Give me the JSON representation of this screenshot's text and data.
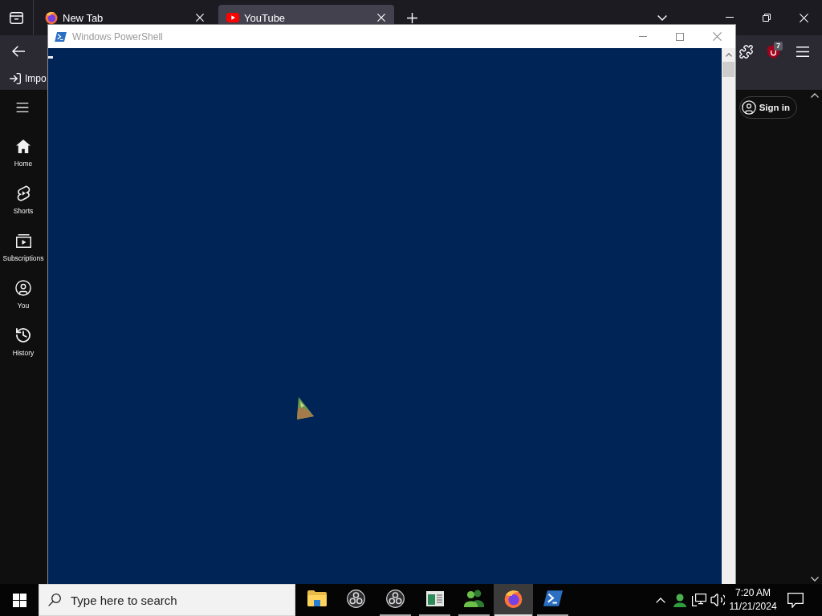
{
  "browser": {
    "tabs": [
      {
        "kind": "firefox",
        "title": "New Tab",
        "selected": false
      },
      {
        "kind": "youtube",
        "title": "YouTube",
        "selected": true
      }
    ],
    "toolbar": {
      "extension_badge": "7"
    },
    "bookmarks": [
      {
        "label": "Impo"
      }
    ]
  },
  "youtube": {
    "sidebar": [
      {
        "kind": "home",
        "label": "Home"
      },
      {
        "kind": "shorts",
        "label": "Shorts"
      },
      {
        "kind": "subscriptions",
        "label": "Subscriptions"
      },
      {
        "kind": "you",
        "label": "You"
      },
      {
        "kind": "history",
        "label": "History"
      }
    ],
    "sign_in": "Sign in"
  },
  "powershell": {
    "title": "Windows PowerShell"
  },
  "taskbar": {
    "search": {
      "placeholder": "Type here to search"
    },
    "apps": [
      {
        "kind": "explorer",
        "running": false,
        "selected": false
      },
      {
        "kind": "obs",
        "running": false,
        "selected": false
      },
      {
        "kind": "obs",
        "running": true,
        "selected": false
      },
      {
        "kind": "window",
        "running": true,
        "selected": false
      },
      {
        "kind": "people",
        "running": true,
        "selected": false
      },
      {
        "kind": "firefox",
        "running": true,
        "selected": true
      },
      {
        "kind": "powershell",
        "running": true,
        "selected": false
      }
    ],
    "clock": {
      "time": "7:20 AM",
      "date": "11/21/2024"
    }
  }
}
